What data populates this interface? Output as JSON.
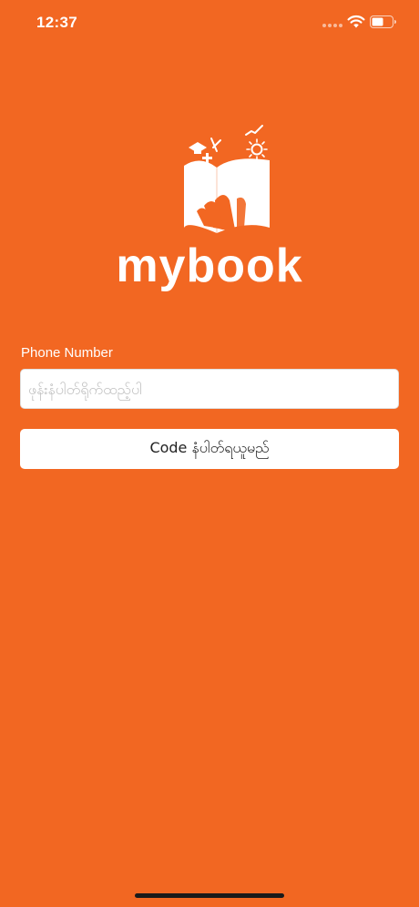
{
  "status_bar": {
    "time": "12:37",
    "icons": [
      "signal-dots-icon",
      "wifi-icon",
      "battery-icon"
    ]
  },
  "brand": {
    "logo_text": "mybook",
    "logo_icon": "open-book-icon",
    "color": "#f26722"
  },
  "form": {
    "phone_label": "Phone Number",
    "phone_placeholder": "ဖုန်းနံပါတ်ရိုက်ထည့်ပါ",
    "phone_value": "",
    "get_code_label": "Code နံပါတ်ရယူမည်"
  }
}
